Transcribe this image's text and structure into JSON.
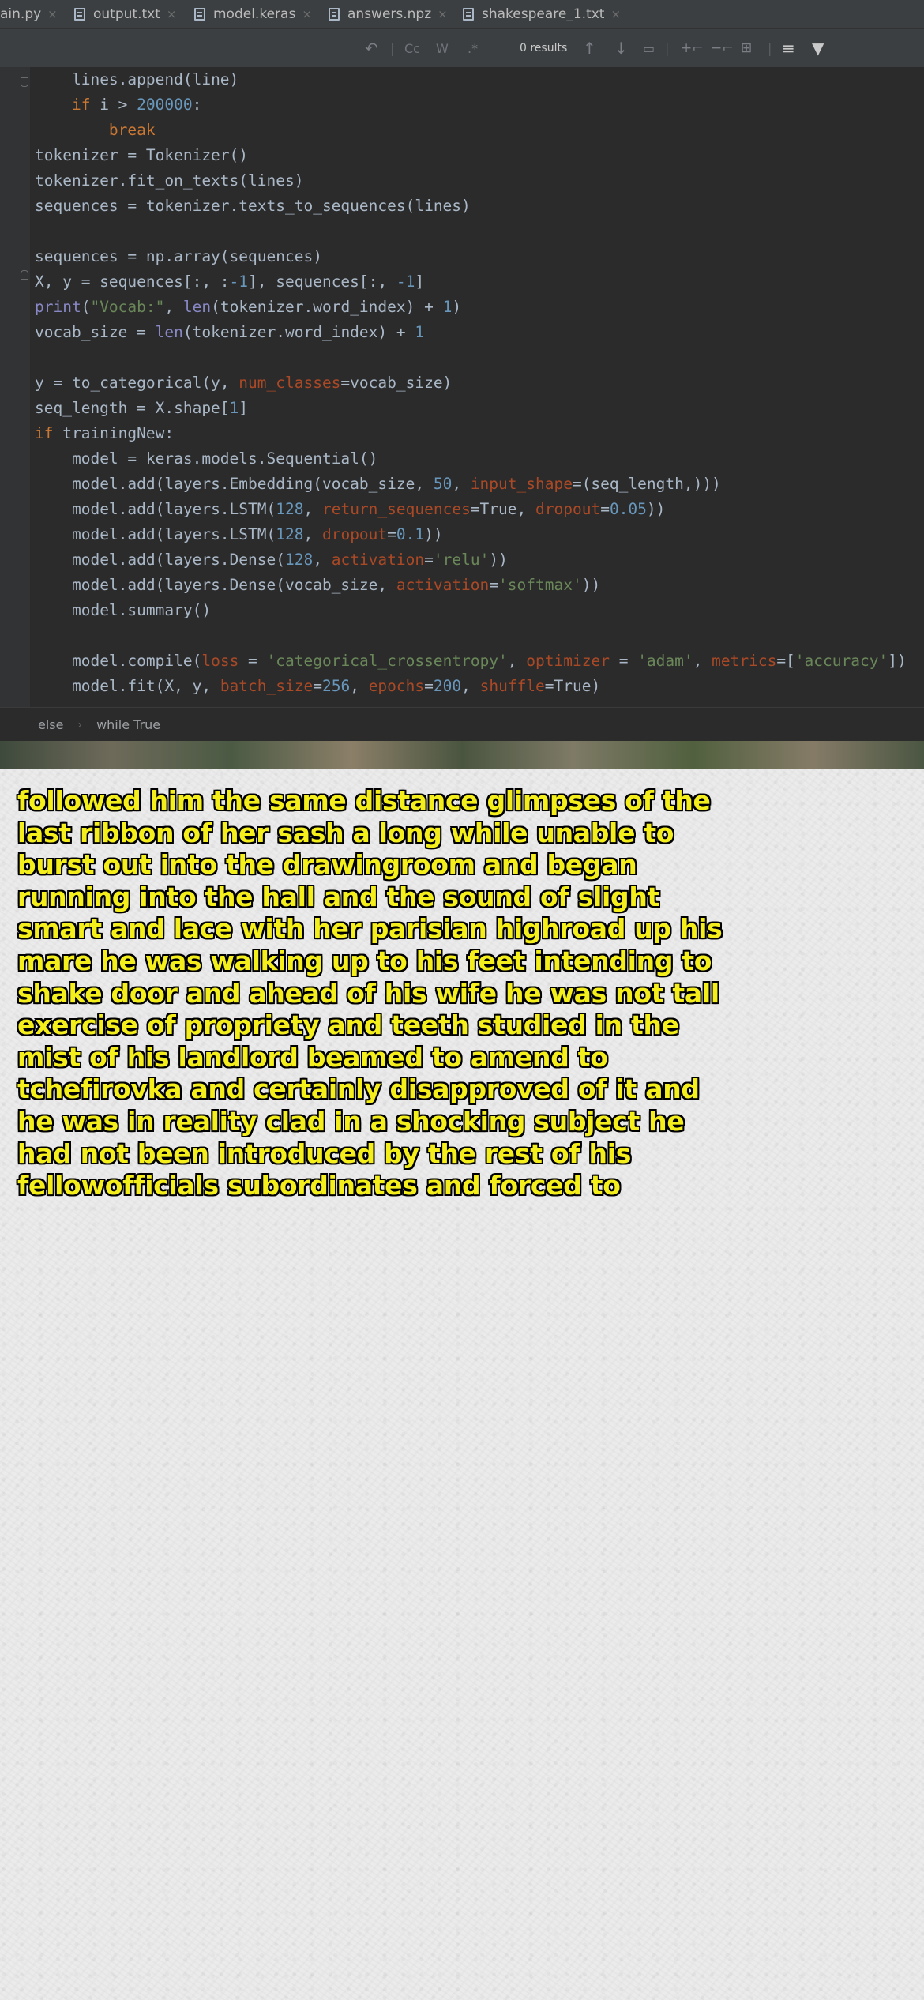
{
  "tabs": [
    {
      "label": "ain.py",
      "close": "×"
    },
    {
      "label": "output.txt",
      "close": "×"
    },
    {
      "label": "model.keras",
      "close": "×"
    },
    {
      "label": "answers.npz",
      "close": "×"
    },
    {
      "label": "shakespeare_1.txt",
      "close": "×"
    }
  ],
  "findbar": {
    "match_case": "Cc",
    "words": "W",
    "regex": ".*",
    "results": "0 results"
  },
  "code": {
    "l1": "lines.append(line)",
    "l2_kw": "if",
    "l2_rest": " i > ",
    "l2_num": "200000",
    "l2_end": ":",
    "l3": "break",
    "l4": "tokenizer = Tokenizer()",
    "l5": "tokenizer.fit_on_texts(lines)",
    "l6": "sequences = tokenizer.texts_to_sequences(lines)",
    "l8": "sequences = np.array(sequences)",
    "l9_a": "X, y = sequences[:, :",
    "l9_b": "-1",
    "l9_c": "], sequences[:, ",
    "l9_d": "-1",
    "l9_e": "]",
    "l10_a": "print",
    "l10_b": "(",
    "l10_c": "\"Vocab:\"",
    "l10_d": ", ",
    "l10_e": "len",
    "l10_f": "(tokenizer.word_index) + ",
    "l10_g": "1",
    "l10_h": ")",
    "l11_a": "vocab_size = ",
    "l11_b": "len",
    "l11_c": "(tokenizer.word_index) + ",
    "l11_d": "1",
    "l13_a": "y = to_categorical(y, ",
    "l13_b": "num_classes",
    "l13_c": "=vocab_size)",
    "l14_a": "seq_length = X.shape[",
    "l14_b": "1",
    "l14_c": "]",
    "l15_a": "if",
    "l15_b": " trainingNew:",
    "l16": "model = keras.models.Sequential()",
    "l17_a": "model.add(layers.Embedding(vocab_size, ",
    "l17_b": "50",
    "l17_c": ", ",
    "l17_d": "input_shape",
    "l17_e": "=(seq_length,)))",
    "l18_a": "model.add(layers.LSTM(",
    "l18_b": "128",
    "l18_c": ", ",
    "l18_d": "return_sequences",
    "l18_e": "=True, ",
    "l18_f": "dropout",
    "l18_g": "=",
    "l18_h": "0.05",
    "l18_i": "))",
    "l19_a": "model.add(layers.LSTM(",
    "l19_b": "128",
    "l19_c": ", ",
    "l19_d": "dropout",
    "l19_e": "=",
    "l19_f": "0.1",
    "l19_g": "))",
    "l20_a": "model.add(layers.Dense(",
    "l20_b": "128",
    "l20_c": ", ",
    "l20_d": "activation",
    "l20_e": "=",
    "l20_f": "'relu'",
    "l20_g": "))",
    "l21_a": "model.add(layers.Dense(vocab_size, ",
    "l21_b": "activation",
    "l21_c": "=",
    "l21_d": "'softmax'",
    "l21_e": "))",
    "l22": "model.summary()",
    "l24_a": "model.compile(",
    "l24_b": "loss",
    "l24_c": " = ",
    "l24_d": "'categorical_crossentropy'",
    "l24_e": ", ",
    "l24_f": "optimizer",
    "l24_g": " = ",
    "l24_h": "'adam'",
    "l24_i": ", ",
    "l24_j": "metrics",
    "l24_k": "=[",
    "l24_l": "'accuracy'",
    "l24_m": "])",
    "l25_a": "model.fit(X, y, ",
    "l25_b": "batch_size",
    "l25_c": "=",
    "l25_d": "256",
    "l25_e": ", ",
    "l25_f": "epochs",
    "l25_g": "=",
    "l25_h": "200",
    "l25_i": ", ",
    "l25_j": "shuffle",
    "l25_k": "=True)"
  },
  "breadcrumb": [
    "else",
    "while True"
  ],
  "generated_text": [
    "followed him the same distance glimpses of the",
    "last ribbon of her sash a long while unable to",
    "burst out into the drawingroom and began",
    "running into the hall and the sound of slight",
    "smart and lace with her parisian highroad up his",
    "mare he was walking up to his feet intending to",
    "shake door and ahead of his wife he was not tall",
    "exercise of propriety and teeth studied in the",
    "mist of his landlord beamed to amend to",
    "tchefirovka and certainly disapproved of it and",
    "he was in reality clad in a shocking subject he",
    "had not been introduced by the rest of his",
    "fellowofficials subordinates and forced to"
  ],
  "colors": {
    "editor_bg": "#2b2b2b",
    "keyword": "#cc7832",
    "number": "#6897bb",
    "string": "#6a8759",
    "param": "#aa4926",
    "text_fill": "#f4ee1c",
    "text_outline": "#000000"
  }
}
